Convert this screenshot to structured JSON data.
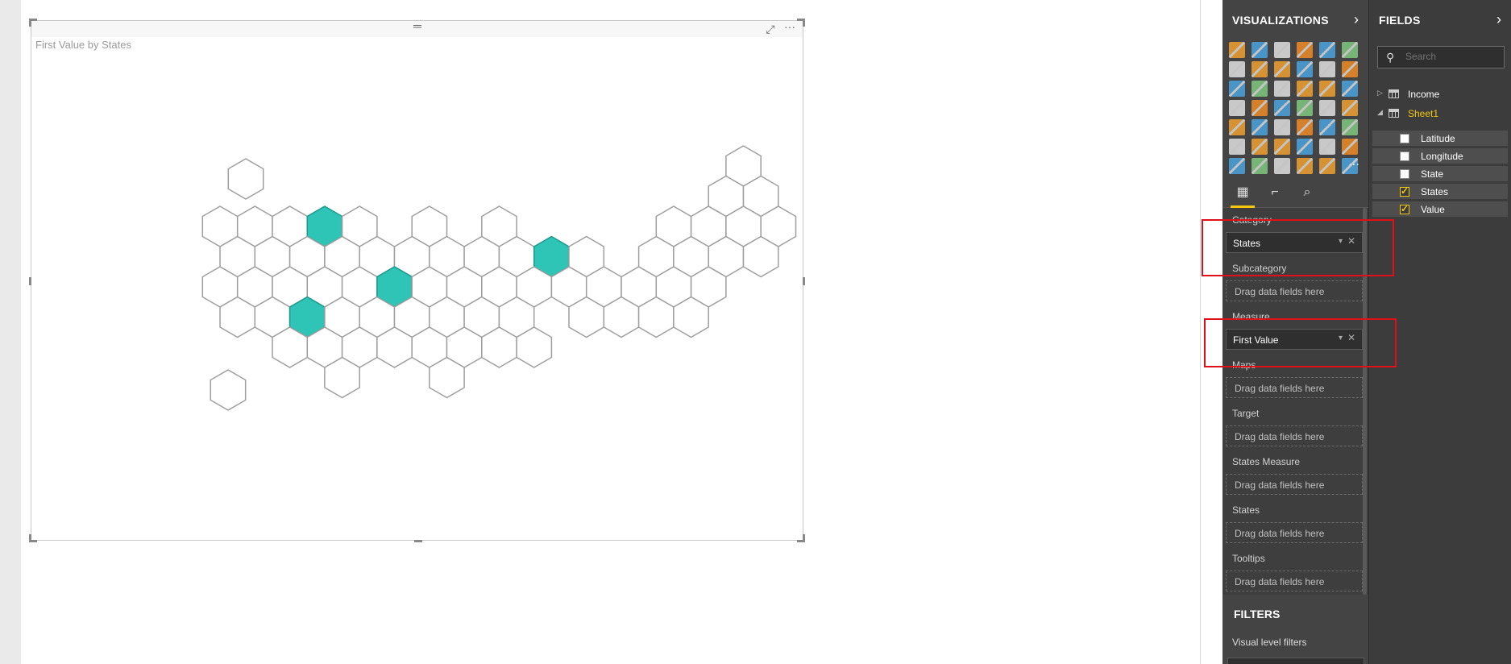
{
  "visual": {
    "title": "First Value by States",
    "highlight_color": "#2ec4b6",
    "hex_stroke": "#9e9e9e"
  },
  "visualizations_pane": {
    "title": "VISUALIZATIONS",
    "tabs": [
      "fields-tab",
      "format-tab",
      "analytics-tab"
    ],
    "wells": [
      {
        "label": "Category",
        "value": "States",
        "filled": true
      },
      {
        "label": "Subcategory",
        "value": "Drag data fields here",
        "filled": false
      },
      {
        "label": "Measure",
        "value": "First Value",
        "filled": true
      },
      {
        "label": "Maps",
        "value": "Drag data fields here",
        "filled": false
      },
      {
        "label": "Target",
        "value": "Drag data fields here",
        "filled": false
      },
      {
        "label": "States Measure",
        "value": "Drag data fields here",
        "filled": false
      },
      {
        "label": "States",
        "value": "Drag data fields here",
        "filled": false
      },
      {
        "label": "Tooltips",
        "value": "Drag data fields here",
        "filled": false
      }
    ],
    "filters_title": "FILTERS",
    "visual_level_filters": "Visual level filters"
  },
  "fields_pane": {
    "title": "FIELDS",
    "search_placeholder": "Search",
    "tables": [
      {
        "name": "Income",
        "expanded": false,
        "color": "#ffffff"
      },
      {
        "name": "Sheet1",
        "expanded": true,
        "color": "#f2c80f"
      }
    ],
    "fields": [
      {
        "name": "Latitude",
        "checked": false
      },
      {
        "name": "Longitude",
        "checked": false
      },
      {
        "name": "State",
        "checked": false
      },
      {
        "name": "States",
        "checked": true
      },
      {
        "name": "Value",
        "checked": true
      }
    ]
  },
  "accent_color": "#f2c80f"
}
